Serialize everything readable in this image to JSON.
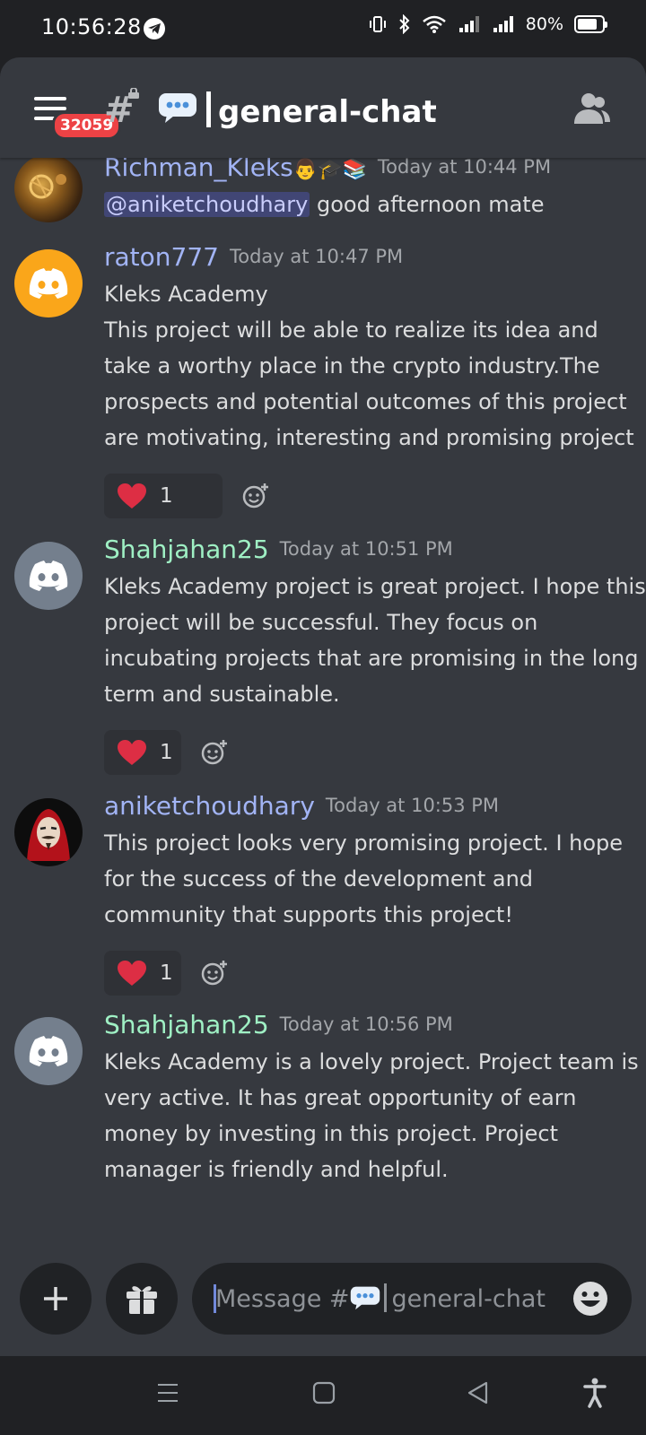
{
  "status_bar": {
    "time": "10:56:28",
    "battery": "80%",
    "battery_level": 0.8
  },
  "header": {
    "badge": "32059",
    "channel_name": "general-chat",
    "icons": [
      "menu-icon",
      "locked-threads-icon",
      "speech-balloon-icon",
      "members-icon"
    ]
  },
  "messages": [
    {
      "author": "Richman_Kleks",
      "author_emoji": "👨🎓📚",
      "author_color": "#a2b4f5",
      "timestamp": "Today at 10:44 PM",
      "mention": "@aniketchoudhary",
      "lines": [
        "good afternoon mate"
      ]
    },
    {
      "author": "raton777",
      "author_color": "#a2b4f5",
      "avatar_color": "#faa61a",
      "timestamp": "Today at 10:47 PM",
      "lines": [
        "Kleks Academy",
        "This project will be able to realize its idea and",
        "take a worthy place in the crypto industry.The",
        "prospects and potential outcomes of this project",
        "are motivating, interesting and promising project"
      ],
      "reaction": {
        "emoji": "heart",
        "count": "1"
      }
    },
    {
      "author": "Shahjahan25",
      "author_color": "#9ff0c4",
      "avatar_color": "#747f8d",
      "timestamp": "Today at 10:51 PM",
      "lines": [
        "Kleks Academy project is great project. I hope this",
        "project will be successful. They focus on",
        "incubating projects that are promising in the long",
        "term and sustainable."
      ],
      "reaction": {
        "emoji": "heart",
        "count": "1"
      }
    },
    {
      "author": "aniketchoudhary",
      "author_color": "#a2b4f5",
      "timestamp": "Today at 10:53 PM",
      "lines": [
        "This project looks very promising project. I hope",
        "for the success of the development and",
        "community that supports this project!"
      ],
      "reaction": {
        "emoji": "heart",
        "count": "1"
      }
    },
    {
      "author": "Shahjahan25",
      "author_color": "#9ff0c4",
      "avatar_color": "#747f8d",
      "timestamp": "Today at 10:56 PM",
      "lines": [
        "Kleks Academy is a lovely project. Project team is",
        "very active. It has great opportunity of earn",
        "money by investing in this project. Project",
        "manager is friendly and helpful."
      ]
    }
  ],
  "composer": {
    "placeholder_prefix": "Message #",
    "placeholder_channel": "general-chat"
  },
  "nav": {
    "icons": [
      "recent-apps-icon",
      "home-icon",
      "back-icon",
      "accessibility-icon"
    ]
  }
}
